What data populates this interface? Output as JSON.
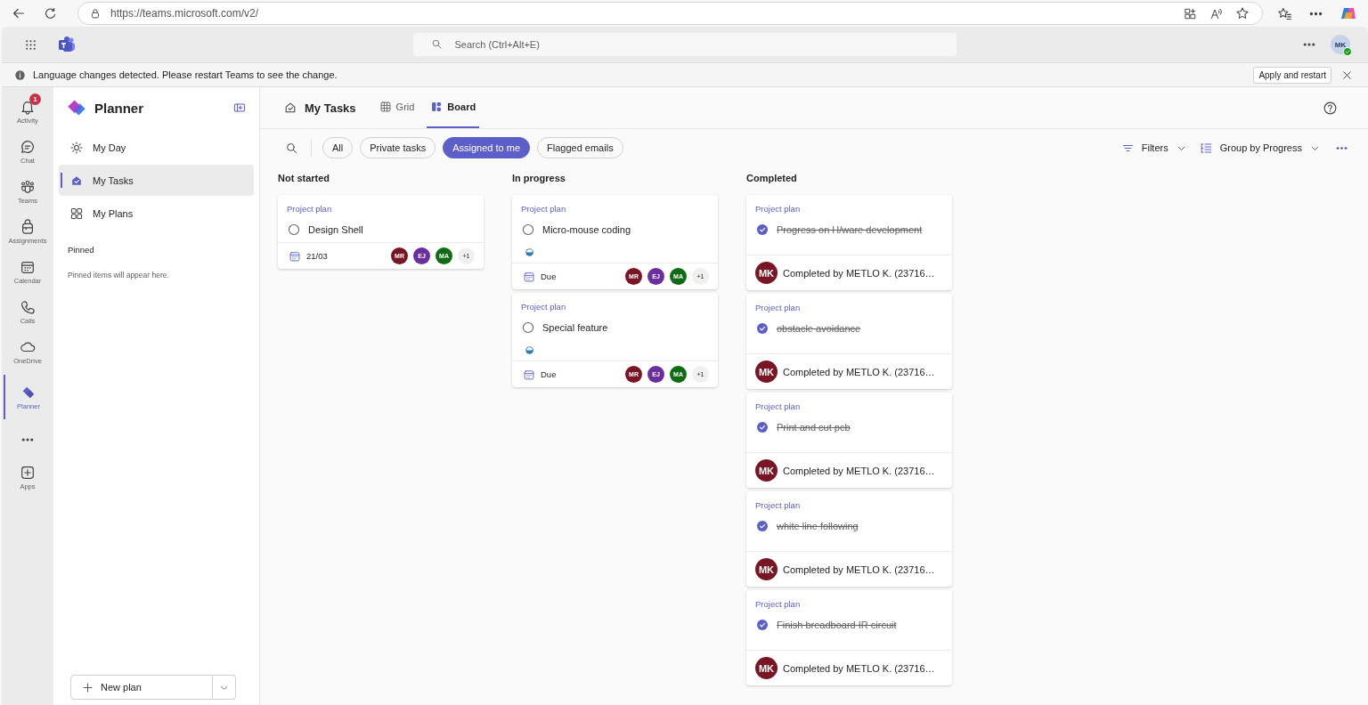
{
  "browser": {
    "url": "https://teams.microsoft.com/v2/"
  },
  "topbar": {
    "search_placeholder": "Search (Ctrl+Alt+E)",
    "avatar": "MK"
  },
  "notice": {
    "text": "Language changes detected. Please restart Teams to see the change.",
    "button": "Apply and restart"
  },
  "rail": [
    {
      "kind": "bell",
      "label": "Activity",
      "badge": "1",
      "selected": false
    },
    {
      "kind": "chat",
      "label": "Chat",
      "selected": false
    },
    {
      "kind": "people",
      "label": "Teams",
      "selected": false
    },
    {
      "kind": "bag",
      "label": "Assignments",
      "selected": false
    },
    {
      "kind": "calendar",
      "label": "Calendar",
      "selected": false
    },
    {
      "kind": "phone",
      "label": "Calls",
      "selected": false
    },
    {
      "kind": "cloud",
      "label": "OneDrive",
      "selected": false
    },
    {
      "kind": "planner",
      "label": "Planner",
      "selected": true
    },
    {
      "kind": "more"
    },
    {
      "kind": "apps",
      "label": "Apps",
      "selected": false
    }
  ],
  "sidebar": {
    "title": "Planner",
    "items": [
      {
        "kind": "day",
        "label": "My Day",
        "selected": false
      },
      {
        "kind": "tasks",
        "label": "My Tasks",
        "selected": true
      },
      {
        "kind": "plans",
        "label": "My Plans",
        "selected": false
      }
    ],
    "pinned_heading": "Pinned",
    "pinned_empty": "Pinned items will appear here.",
    "new_plan": "New plan"
  },
  "header": {
    "title": "My Tasks",
    "views": [
      {
        "kind": "grid",
        "label": "Grid",
        "selected": false
      },
      {
        "kind": "board",
        "label": "Board",
        "selected": true
      }
    ]
  },
  "filters": [
    {
      "label": "All",
      "selected": false
    },
    {
      "label": "Private tasks",
      "selected": false
    },
    {
      "label": "Assigned to me",
      "selected": true
    },
    {
      "label": "Flagged emails",
      "selected": false
    }
  ],
  "toolbar": {
    "filters": "Filters",
    "group_by": "Group by Progress"
  },
  "columns": [
    {
      "title": "Not started",
      "cards": [
        {
          "plan": "Project plan",
          "title": "Design Shell",
          "completed": false,
          "in_progress": false,
          "due": "21/03",
          "assignees": [
            {
              "initials": "MR",
              "color": "#7a1523"
            },
            {
              "initials": "EJ",
              "color": "#6a2f9e"
            },
            {
              "initials": "MA",
              "color": "#0f6b14"
            }
          ],
          "more": "+1"
        }
      ]
    },
    {
      "title": "In progress",
      "cards": [
        {
          "plan": "Project plan",
          "title": "Micro-mouse coding",
          "completed": false,
          "in_progress": true,
          "due": "Due",
          "assignees": [
            {
              "initials": "MR",
              "color": "#7a1523"
            },
            {
              "initials": "EJ",
              "color": "#6a2f9e"
            },
            {
              "initials": "MA",
              "color": "#0f6b14"
            }
          ],
          "more": "+1"
        },
        {
          "plan": "Project plan",
          "title": "Special feature",
          "completed": false,
          "in_progress": true,
          "due": "Due",
          "assignees": [
            {
              "initials": "MR",
              "color": "#7a1523"
            },
            {
              "initials": "EJ",
              "color": "#6a2f9e"
            },
            {
              "initials": "MA",
              "color": "#0f6b14"
            }
          ],
          "more": "+1"
        }
      ]
    },
    {
      "title": "Completed",
      "cards": [
        {
          "plan": "Project plan",
          "title": "Progress on H/ware development",
          "completed": true,
          "avatar": "MK",
          "completed_by": "Completed by METLO K. (23716…"
        },
        {
          "plan": "Project plan",
          "title": "obstacle avoidance",
          "completed": true,
          "avatar": "MK",
          "completed_by": "Completed by METLO K. (23716…"
        },
        {
          "plan": "Project plan",
          "title": "Print and cut pcb",
          "completed": true,
          "avatar": "MK",
          "completed_by": "Completed by METLO K. (23716…"
        },
        {
          "plan": "Project plan",
          "title": "white line following",
          "completed": true,
          "avatar": "MK",
          "completed_by": "Completed by METLO K. (23716…"
        },
        {
          "plan": "Project plan",
          "title": "Finish breadboard IR circuit",
          "completed": true,
          "avatar": "MK",
          "completed_by": "Completed by METLO K. (23716…"
        }
      ]
    }
  ]
}
